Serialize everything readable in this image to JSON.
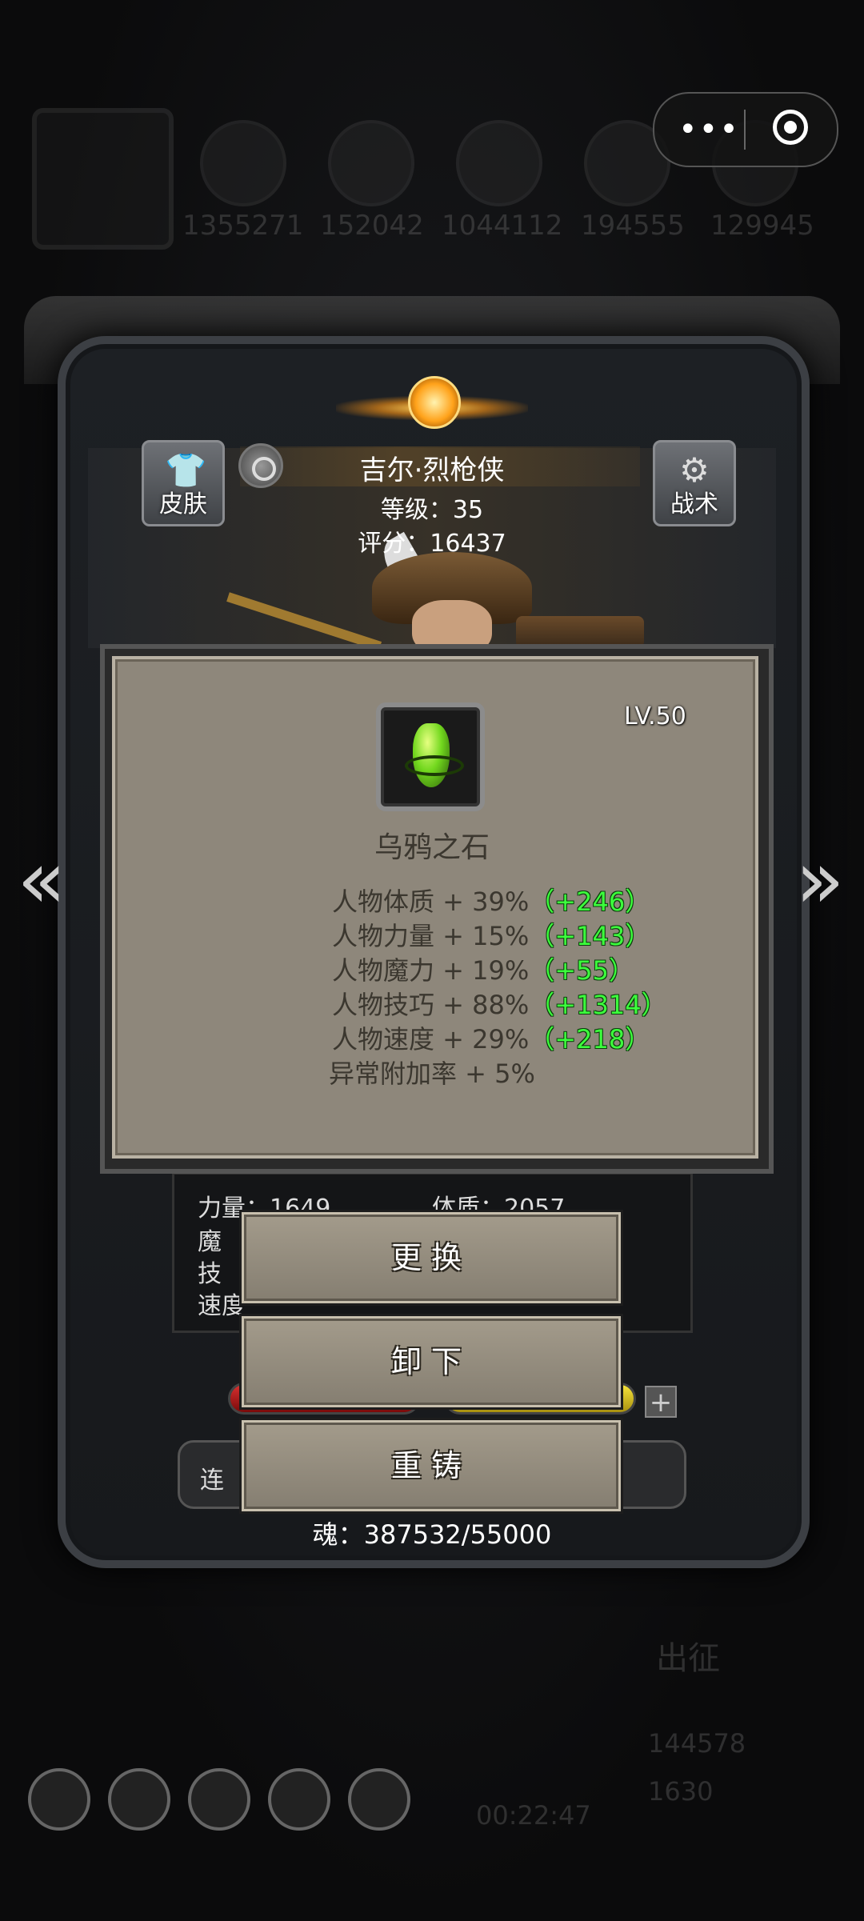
{
  "resources": [
    "1355271",
    "152042",
    "1044112",
    "194555",
    "129945"
  ],
  "character": {
    "name": "吉尔·烈枪侠",
    "level": "等级：35",
    "score": "评分：16437",
    "skin_label": "皮肤",
    "tactics_label": "战术"
  },
  "item": {
    "level": "LV.50",
    "name": "乌鸦之石",
    "stats": [
      {
        "text": "人物体质 + 39%",
        "bonus": "（+246）"
      },
      {
        "text": "人物力量 + 15%",
        "bonus": "（+143）"
      },
      {
        "text": "人物魔力 + 19%",
        "bonus": "（+55）"
      },
      {
        "text": "人物技巧 + 88%",
        "bonus": "（+1314）"
      },
      {
        "text": "人物速度 + 29%",
        "bonus": "（+218）"
      }
    ],
    "extra": "异常附加率 + 5%"
  },
  "attributes": {
    "strength": "力量：1649",
    "constitution": "体质：2057",
    "magic_prefix": "魔",
    "skill_prefix": "技",
    "speed_prefix": "速度"
  },
  "actions": {
    "replace": "更换",
    "unequip": "卸下",
    "reforge": "重铸"
  },
  "link_prefix": "连",
  "soul": "魂：387532/55000",
  "background": {
    "depart": "出征",
    "timer": "00:22:47",
    "gold": "144578",
    "gems": "1630"
  }
}
